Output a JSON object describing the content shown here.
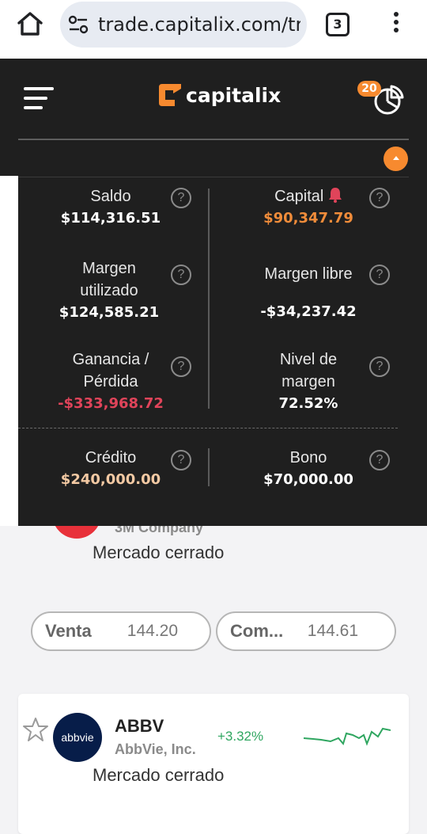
{
  "browser": {
    "url": "trade.capitalix.com/tr",
    "tab_count": "3"
  },
  "header": {
    "brand": "capitalix",
    "portfolio_badge": "20"
  },
  "account": {
    "saldo": {
      "label": "Saldo",
      "value": "$114,316.51"
    },
    "capital": {
      "label": "Capital",
      "value": "$90,347.79"
    },
    "margen_utilizado": {
      "label": "Margen utilizado",
      "value": "$124,585.21"
    },
    "margen_libre": {
      "label": "Margen libre",
      "value": "-$34,237.42"
    },
    "ganancia": {
      "label": "Ganancia / Pérdida",
      "value": "-$333,968.72"
    },
    "nivel_margen": {
      "label": "Nivel de margen",
      "value": "72.52%"
    },
    "credito": {
      "label": "Crédito",
      "value": "$240,000.00"
    },
    "bono": {
      "label": "Bono",
      "value": "$70,000.00"
    },
    "help_glyph": "?"
  },
  "colors": {
    "accent": "#f78a2f",
    "negative": "#e0445a",
    "credit": "#f3c9a3",
    "positive": "#2fa660"
  },
  "stocks": [
    {
      "company": "3M Company",
      "status": "Mercado cerrado",
      "sell_label": "Venta",
      "sell_price": "144.20",
      "buy_label": "Com...",
      "buy_price": "144.61"
    },
    {
      "ticker": "ABBV",
      "company": "AbbVie, Inc.",
      "change": "+3.32%",
      "status": "Mercado cerrado",
      "logo_text": "abbvie"
    }
  ]
}
